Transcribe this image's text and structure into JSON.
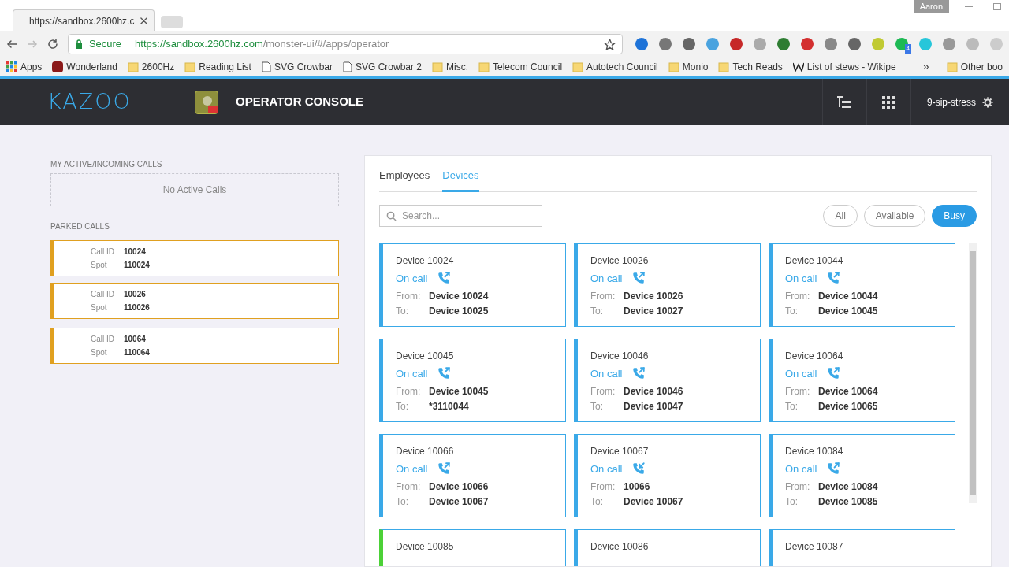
{
  "browser": {
    "tab_title": "https://sandbox.2600hz.c",
    "user": "Aaron",
    "secure_label": "Secure",
    "url_host": "https://sandbox.2600hz.com",
    "url_path": "/monster-ui/#/apps/operator",
    "bookmarks": [
      {
        "label": "Apps",
        "kind": "apps"
      },
      {
        "label": "Wonderland",
        "kind": "w"
      },
      {
        "label": "2600Hz",
        "kind": "folder"
      },
      {
        "label": "Reading List",
        "kind": "folder"
      },
      {
        "label": "SVG Crowbar",
        "kind": "page"
      },
      {
        "label": "SVG Crowbar 2",
        "kind": "page"
      },
      {
        "label": "Misc.",
        "kind": "folder"
      },
      {
        "label": "Telecom Council",
        "kind": "folder"
      },
      {
        "label": "Autotech Council",
        "kind": "folder"
      },
      {
        "label": "Monio",
        "kind": "folder"
      },
      {
        "label": "Tech Reads",
        "kind": "folder"
      },
      {
        "label": "List of stews - Wikipe",
        "kind": "wiki"
      }
    ],
    "overflow": "»",
    "other_bookmarks": "Other boo",
    "extension_badge": "4"
  },
  "header": {
    "logo": "KAZOO",
    "app_title": "OPERATOR CONSOLE",
    "account": "9-sip-stress"
  },
  "active_calls": {
    "heading": "MY ACTIVE/INCOMING CALLS",
    "empty": "No Active Calls"
  },
  "parked_calls": {
    "heading": "PARKED CALLS",
    "calls": [
      {
        "id_label": "Call ID",
        "id": "10024",
        "spot_label": "Spot",
        "spot": "110024"
      },
      {
        "id_label": "Call ID",
        "id": "10026",
        "spot_label": "Spot",
        "spot": "110026"
      },
      {
        "id_label": "Call ID",
        "id": "10064",
        "spot_label": "Spot",
        "spot": "110064"
      }
    ]
  },
  "tabs": [
    {
      "label": "Employees",
      "selected": false
    },
    {
      "label": "Devices",
      "selected": true
    }
  ],
  "search": {
    "placeholder": "Search..."
  },
  "filters": [
    {
      "label": "All",
      "selected": false
    },
    {
      "label": "Available",
      "selected": false
    },
    {
      "label": "Busy",
      "selected": true
    }
  ],
  "devices": [
    {
      "name": "Device 10024",
      "status": "On call",
      "incoming": false,
      "from_label": "From:",
      "from": "Device 10024",
      "to_label": "To:",
      "to": "Device 10025",
      "color": "#3aa9e8"
    },
    {
      "name": "Device 10026",
      "status": "On call",
      "incoming": false,
      "from_label": "From:",
      "from": "Device 10026",
      "to_label": "To:",
      "to": "Device 10027",
      "color": "#3aa9e8"
    },
    {
      "name": "Device 10044",
      "status": "On call",
      "incoming": false,
      "from_label": "From:",
      "from": "Device 10044",
      "to_label": "To:",
      "to": "Device 10045",
      "color": "#3aa9e8"
    },
    {
      "name": "Device 10045",
      "status": "On call",
      "incoming": false,
      "from_label": "From:",
      "from": "Device 10045",
      "to_label": "To:",
      "to": "*3110044",
      "color": "#3aa9e8"
    },
    {
      "name": "Device 10046",
      "status": "On call",
      "incoming": false,
      "from_label": "From:",
      "from": "Device 10046",
      "to_label": "To:",
      "to": "Device 10047",
      "color": "#3aa9e8"
    },
    {
      "name": "Device 10064",
      "status": "On call",
      "incoming": false,
      "from_label": "From:",
      "from": "Device 10064",
      "to_label": "To:",
      "to": "Device 10065",
      "color": "#3aa9e8"
    },
    {
      "name": "Device 10066",
      "status": "On call",
      "incoming": false,
      "from_label": "From:",
      "from": "Device 10066",
      "to_label": "To:",
      "to": "Device 10067",
      "color": "#3aa9e8"
    },
    {
      "name": "Device 10067",
      "status": "On call",
      "incoming": true,
      "from_label": "From:",
      "from": "10066",
      "to_label": "To:",
      "to": "Device 10067",
      "color": "#3aa9e8"
    },
    {
      "name": "Device 10084",
      "status": "On call",
      "incoming": false,
      "from_label": "From:",
      "from": "Device 10084",
      "to_label": "To:",
      "to": "Device 10085",
      "color": "#3aa9e8"
    },
    {
      "name": "Device 10085",
      "color": "#4cd137"
    },
    {
      "name": "Device 10086",
      "color": "#3aa9e8"
    },
    {
      "name": "Device 10087",
      "color": "#3aa9e8"
    }
  ]
}
